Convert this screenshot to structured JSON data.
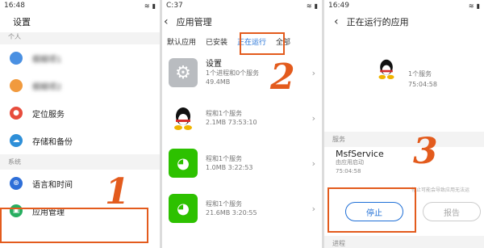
{
  "panel1": {
    "status": {
      "time": "16:48"
    },
    "title": "设置",
    "section_top": "个人",
    "blurred_items": [
      "模糊项1",
      "模糊项2"
    ],
    "items": [
      {
        "label": "定位服务"
      },
      {
        "label": "存储和备份"
      }
    ],
    "section_system": "系统",
    "items2": [
      {
        "label": "语言和时间"
      },
      {
        "label": "应用管理"
      }
    ],
    "step": "1"
  },
  "panel2": {
    "status": {
      "time": "C:37"
    },
    "title": "应用管理",
    "tabs": [
      "默认应用",
      "已安装",
      "正在运行",
      "全部"
    ],
    "apps": [
      {
        "name": "设置",
        "line1": "1个进程和0个服务",
        "line2": "49.4MB"
      },
      {
        "name": "",
        "line1": "程和1个服务",
        "line2": "2.1MB   73:53:10"
      },
      {
        "name": "",
        "line1": "程和1个服务",
        "line2": "1.0MB   3:22:53"
      },
      {
        "name": "",
        "line1": "程和1个服务",
        "line2": "21.6MB  3:20:55"
      }
    ],
    "step": "2"
  },
  "panel3": {
    "status": {
      "time": "16:49"
    },
    "title": "正在运行的应用",
    "top_info": {
      "line1": "1个服务",
      "line2": "75:04:58"
    },
    "section_service": "服务",
    "service": {
      "name": "MsfService",
      "sub": "由应用启动",
      "time": "75:04:58"
    },
    "warning": "停止可能会导致应用无法运",
    "stop_label": "停止",
    "report_label": "报告",
    "section_process": "进程",
    "step": "3"
  },
  "colors": {
    "accent": "#e35b1d",
    "blue": "#1f6fd6",
    "wechat": "#2dc100"
  }
}
